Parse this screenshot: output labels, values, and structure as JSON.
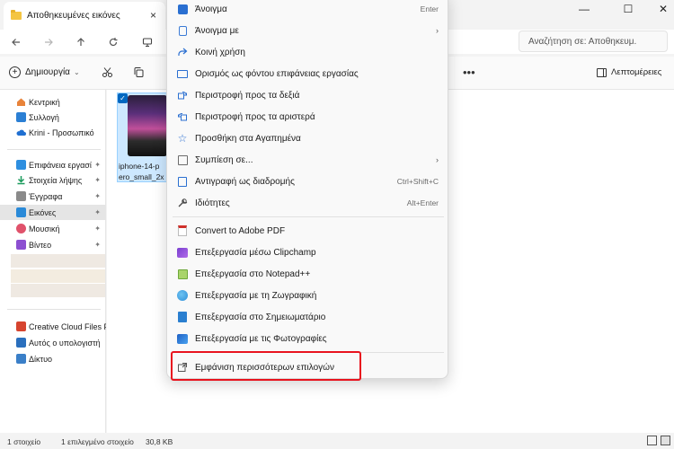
{
  "window": {
    "tab_title": "Αποθηκευμένες εικόνες",
    "close_tab": "×",
    "minimize": "—",
    "maximize": "☐",
    "close": "✕"
  },
  "nav": {
    "search_placeholder": "Αναζήτηση σε: Αποθηκευμ."
  },
  "command_bar": {
    "new_label": "Δημιουργία",
    "details_label": "Λεπτομέρειες",
    "more": "•••"
  },
  "sidebar": {
    "items": [
      {
        "label": "Κεντρική",
        "color": "#e8833a"
      },
      {
        "label": "Συλλογή",
        "color": "#2b7fd4"
      },
      {
        "label": "Krini - Προσωπικό",
        "color": "#1f6fd1"
      },
      {
        "label": "Επιφάνεια εργασί",
        "color": "#2e8fe0",
        "pinned": true
      },
      {
        "label": "Στοιχεία λήψης",
        "color": "#1a9a5c",
        "pinned": true
      },
      {
        "label": "Έγγραφα",
        "color": "#8a8a8a",
        "pinned": true
      },
      {
        "label": "Εικόνες",
        "color": "#2a8ad8",
        "pinned": true,
        "selected": true
      },
      {
        "label": "Μουσική",
        "color": "#e0526b",
        "pinned": true
      },
      {
        "label": "Βίντεο",
        "color": "#8c4fd1",
        "pinned": true
      },
      {
        "label": "Creative Cloud Files F",
        "color": "#d6442f"
      },
      {
        "label": "Αυτός ο υπολογιστή",
        "color": "#2a6fbd"
      },
      {
        "label": "Δίκτυο",
        "color": "#3a7fc8"
      }
    ],
    "pin_glyph": "📌"
  },
  "file": {
    "name": "iphone-14-pro_small_2x",
    "name_line1": "iphone-14-p",
    "name_line2": "ero_small_2x",
    "check": "✓"
  },
  "status": {
    "count": "1 στοιχείο",
    "selected": "1 επιλεγμένο στοιχείο",
    "size": "30,8 KB"
  },
  "context_menu": {
    "items": [
      {
        "label": "Άνοιγμα",
        "shortcut": "Enter",
        "icon": "image-icon",
        "color": "#2a6fd1"
      },
      {
        "label": "Άνοιγμα με",
        "submenu": true,
        "icon": "open-with-icon",
        "color": "#3b7bd6"
      },
      {
        "label": "Κοινή χρήση",
        "icon": "share-icon",
        "color": "#2a6fd1"
      },
      {
        "label": "Ορισμός ως φόντου επιφάνειας εργασίας",
        "icon": "wallpaper-icon",
        "color": "#2a6fd1"
      },
      {
        "label": "Περιστροφή προς τα δεξιά",
        "icon": "rotate-right-icon",
        "color": "#2a6fd1"
      },
      {
        "label": "Περιστροφή προς τα αριστερά",
        "icon": "rotate-left-icon",
        "color": "#2a6fd1"
      },
      {
        "label": "Προσθήκη στα Αγαπημένα",
        "icon": "star-icon",
        "color": "#2a6fd1"
      },
      {
        "label": "Συμπίεση σε...",
        "submenu": true,
        "icon": "zip-icon",
        "color": "#6b6b6b"
      },
      {
        "label": "Αντιγραφή ως διαδρομής",
        "shortcut": "Ctrl+Shift+C",
        "icon": "copy-path-icon",
        "color": "#2a6fd1"
      },
      {
        "label": "Ιδιότητες",
        "shortcut": "Alt+Enter",
        "icon": "wrench-icon",
        "color": "#444444"
      },
      {
        "label": "Convert to Adobe PDF",
        "icon": "pdf-icon",
        "color": "#d0302a"
      },
      {
        "label": "Επεξεργασία μέσω Clipchamp",
        "icon": "clipchamp-icon",
        "color": "#7a3fd0"
      },
      {
        "label": "Επεξεργασία στο Notepad++",
        "icon": "notepadpp-icon",
        "color": "#6ea83a"
      },
      {
        "label": "Επεξεργασία με τη Ζωγραφική",
        "icon": "paint-icon",
        "color": "#2f8fd8"
      },
      {
        "label": "Επεξεργασία στο Σημειωματάριο",
        "icon": "notepad-icon",
        "color": "#2a7fd0"
      },
      {
        "label": "Επεξεργασία με τις Φωτογραφίες",
        "icon": "photos-icon",
        "color": "#2a6fd1"
      },
      {
        "label": "Εμφάνιση περισσότερων επιλογών",
        "icon": "more-options-icon",
        "color": "#555555"
      }
    ],
    "arrow_glyph": "›"
  },
  "colors": {
    "accent": "#0067c0",
    "highlight_box": "#e8131e"
  }
}
